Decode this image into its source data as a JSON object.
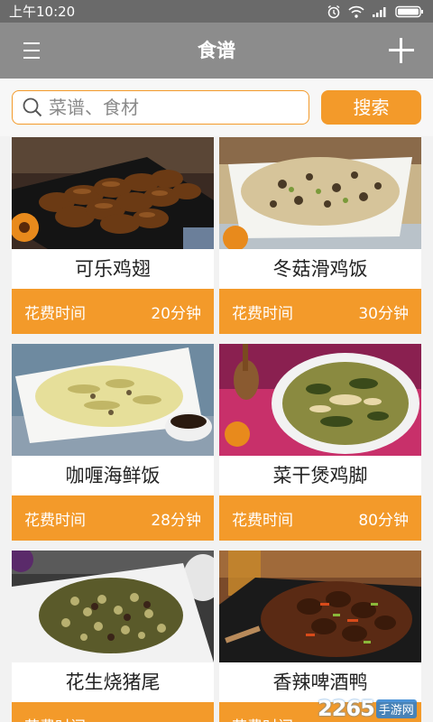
{
  "status_bar": {
    "time": "上午10:20"
  },
  "app_bar": {
    "title": "食谱"
  },
  "search": {
    "placeholder": "菜谱、食材",
    "button_label": "搜索"
  },
  "recipes": [
    {
      "name": "可乐鸡翅",
      "time_label": "花费时间",
      "duration": "20分钟"
    },
    {
      "name": "冬菇滑鸡饭",
      "time_label": "花费时间",
      "duration": "30分钟"
    },
    {
      "name": "咖喱海鲜饭",
      "time_label": "花费时间",
      "duration": "28分钟"
    },
    {
      "name": "菜干煲鸡脚",
      "time_label": "花费时间",
      "duration": "80分钟"
    },
    {
      "name": "花生烧猪尾",
      "time_label": "花费时间",
      "duration": ""
    },
    {
      "name": "香辣啤酒鸭",
      "time_label": "花费时间",
      "duration": ""
    }
  ],
  "watermark": {
    "brand": "2265",
    "sub": "手游网"
  },
  "colors": {
    "accent": "#f39a2a",
    "app_bar": "#8c8c8c",
    "status_bar": "#6a6a6a"
  }
}
